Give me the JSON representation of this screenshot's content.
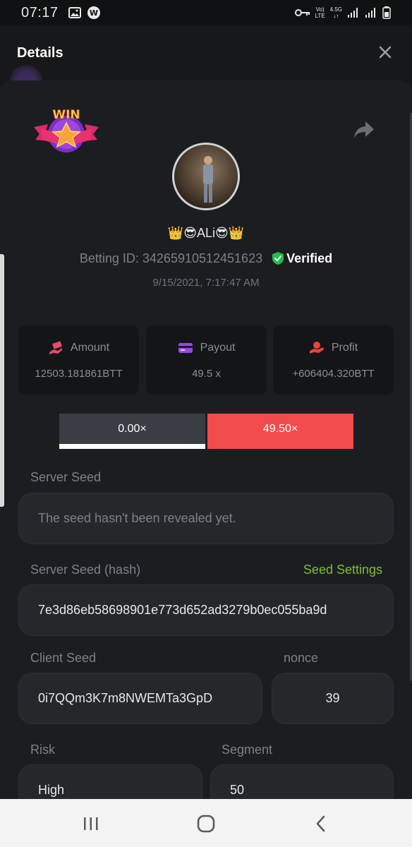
{
  "status_bar": {
    "time": "07:17",
    "network_top": "Vo)",
    "network_bottom": "LTE",
    "signal_top": "4.5G",
    "signal_bottom": "↓↑"
  },
  "header": {
    "title": "Details"
  },
  "badge": {
    "text": "WIN"
  },
  "user": {
    "name": "👑😎ALi😎👑",
    "betting_id": "Betting ID: 34265910512451623",
    "verified": "Verified",
    "timestamp": "9/15/2021, 7:17:47 AM"
  },
  "stats": [
    {
      "label": "Amount",
      "value": "12503.181861BTT",
      "icon": "money-hand-icon",
      "color": "#e84a6a"
    },
    {
      "label": "Payout",
      "value": "49.5 x",
      "icon": "card-icon",
      "color": "#9b48e8"
    },
    {
      "label": "Profit",
      "value": "+606404.320BTT",
      "icon": "coin-hand-icon",
      "color": "#e8453c"
    }
  ],
  "multiplier": {
    "left": "0.00×",
    "right": "49.50×"
  },
  "server_seed": {
    "label": "Server Seed",
    "value": "The seed hasn't been revealed yet."
  },
  "server_seed_hash": {
    "label": "Server Seed (hash)",
    "link": "Seed Settings",
    "value": "7e3d86eb58698901e773d652ad3279b0ec055ba9d"
  },
  "client_seed": {
    "label": "Client Seed",
    "value": "0i7QQm3K7m8NWEMTa3GpD"
  },
  "nonce": {
    "label": "nonce",
    "value": "39"
  },
  "risk": {
    "label": "Risk",
    "value": "High"
  },
  "segment": {
    "label": "Segment",
    "value": "50"
  },
  "colors": {
    "accent_green": "#7cbf3b",
    "accent_red": "#f24b4b",
    "verified_green": "#1fbf4a"
  }
}
